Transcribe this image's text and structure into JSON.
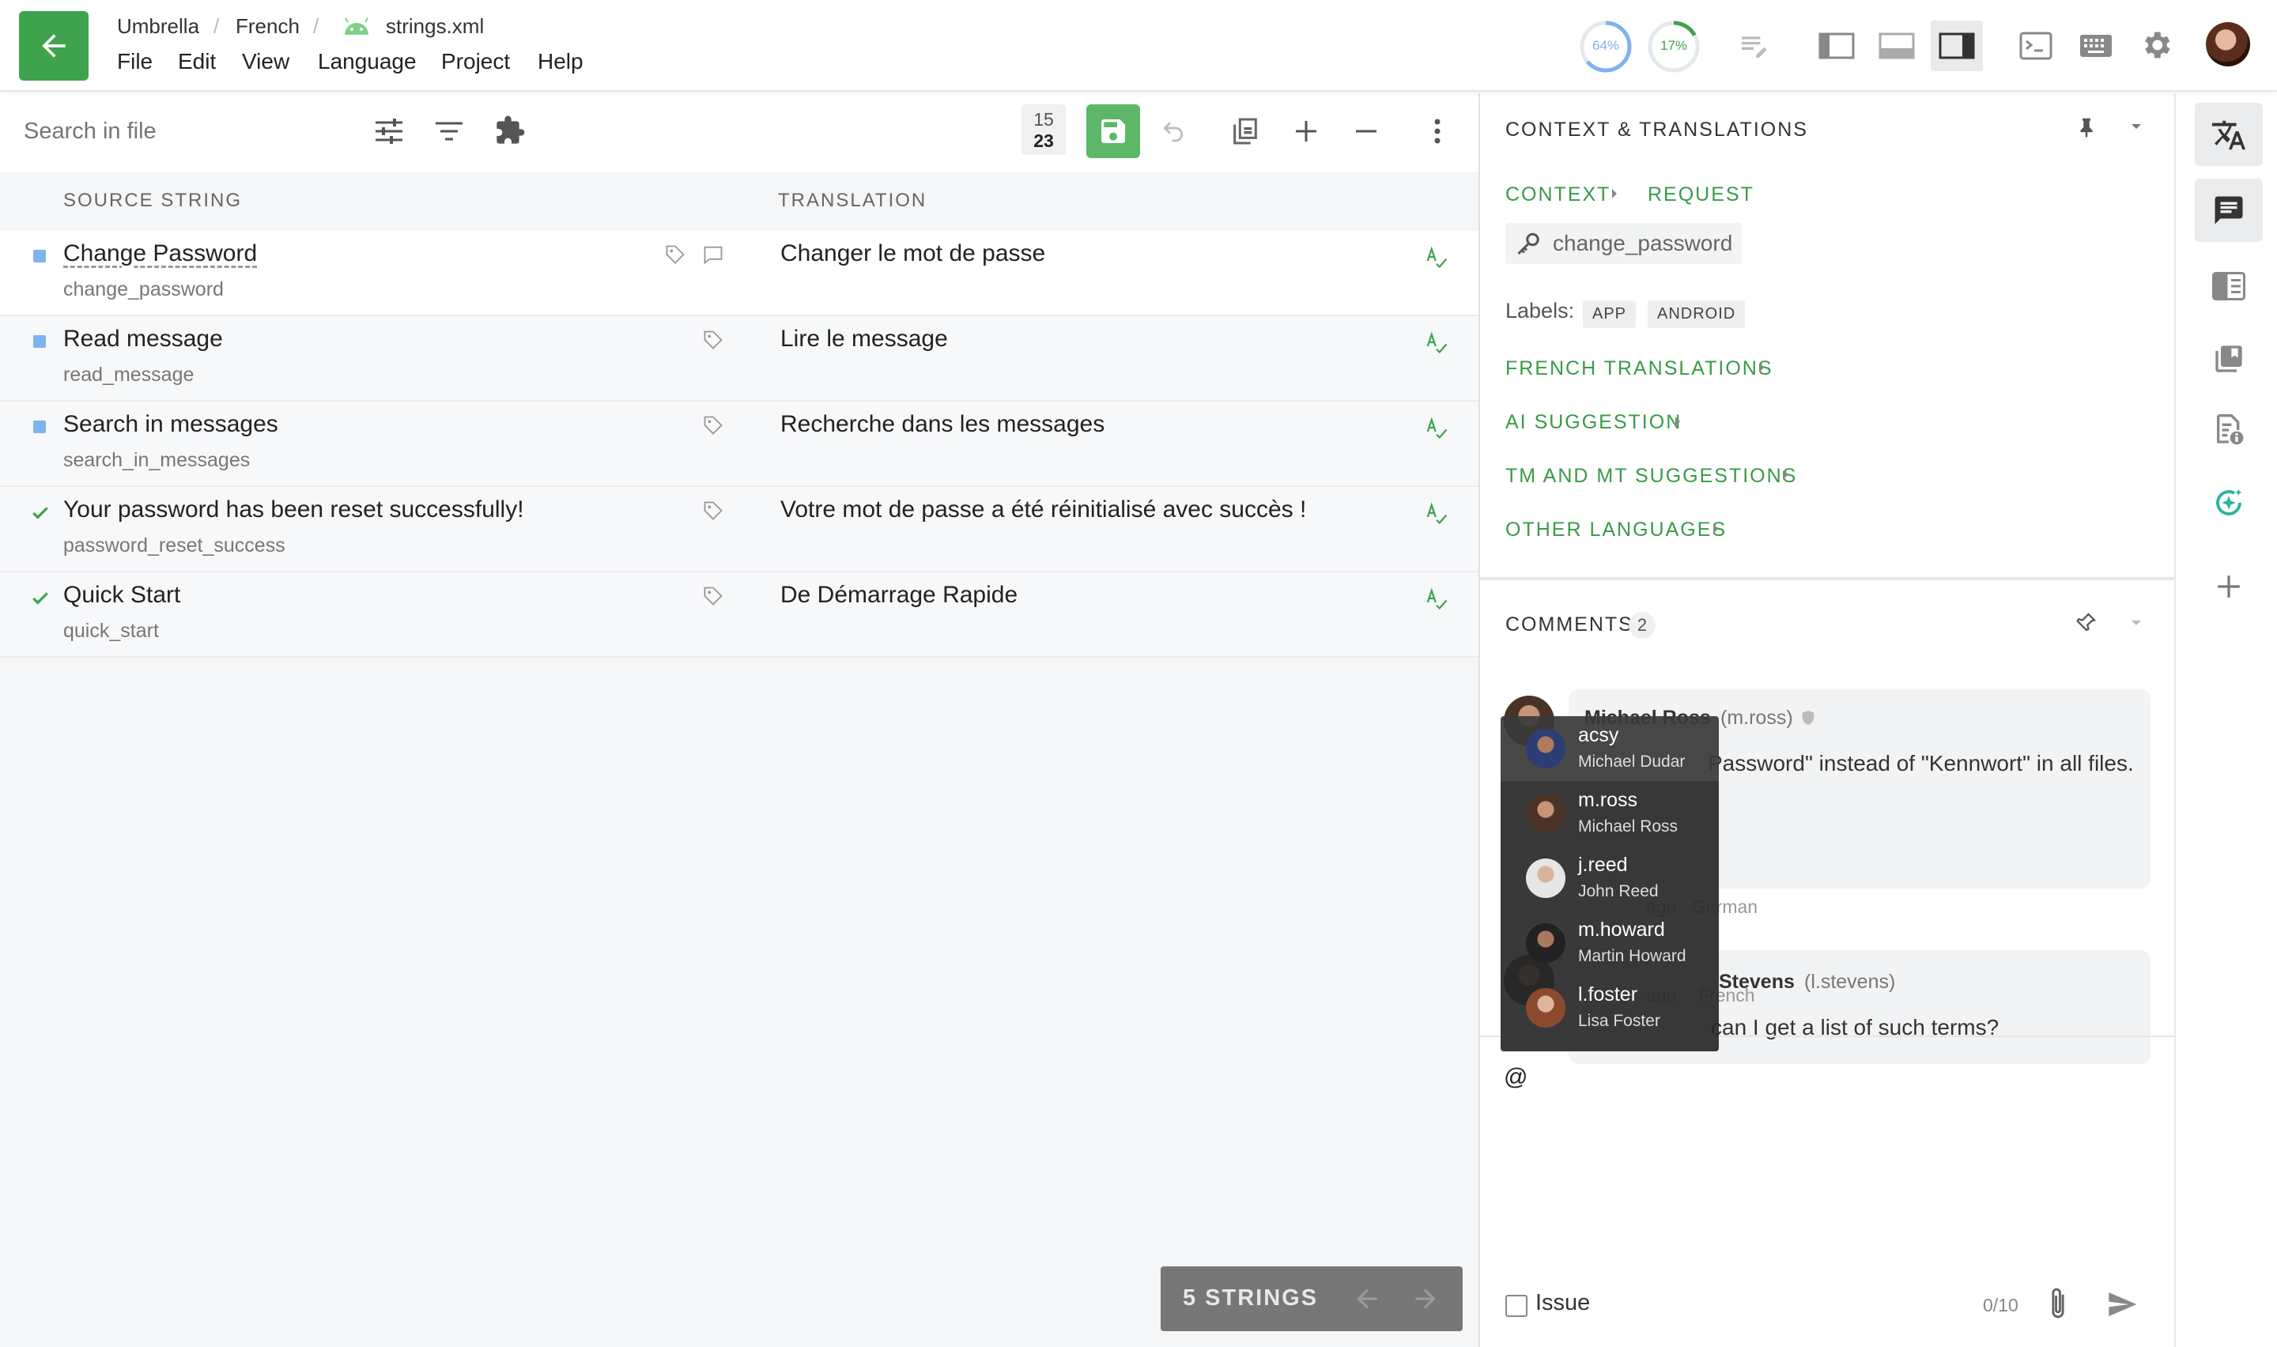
{
  "breadcrumb": {
    "project": "Umbrella",
    "language": "French",
    "file": "strings.xml"
  },
  "menu": [
    "File",
    "Edit",
    "View",
    "Language",
    "Project",
    "Help"
  ],
  "progress": {
    "translated": "64%",
    "translated_value": 0.64,
    "approved": "17%",
    "approved_value": 0.17
  },
  "colors": {
    "accent": "#3fa34d",
    "link": "#3a9a48",
    "unconfirmed": "#7fb2ee"
  },
  "editor": {
    "search_placeholder": "Search in file",
    "counter_top": "15",
    "counter_bottom": "23",
    "col_source": "SOURCE STRING",
    "col_translation": "TRANSLATION",
    "rows": [
      {
        "source": "Change Password",
        "key": "change_password",
        "translation": "Changer le mot de passe",
        "status": "unconfirmed"
      },
      {
        "source": "Read message",
        "key": "read_message",
        "translation": "Lire le message",
        "status": "unconfirmed"
      },
      {
        "source": "Search in messages",
        "key": "search_in_messages",
        "translation": "Recherche dans les messages",
        "status": "unconfirmed"
      },
      {
        "source": "Your password has been reset successfully!",
        "key": "password_reset_success",
        "translation": "Votre mot de passe a été réinitialisé avec succès !",
        "status": "approved"
      },
      {
        "source": "Quick Start",
        "key": "quick_start",
        "translation": "De Démarrage Rapide",
        "status": "approved"
      }
    ],
    "strings_count_label": "5 STRINGS"
  },
  "context_panel": {
    "title": "CONTEXT & TRANSLATIONS",
    "tab_context": "CONTEXT",
    "tab_request": "REQUEST",
    "key": "change_password",
    "labels_label": "Labels:",
    "labels": [
      "APP",
      "ANDROID"
    ],
    "sections": [
      "FRENCH TRANSLATIONS",
      "AI SUGGESTION",
      "TM AND MT SUGGESTIONS",
      "OTHER LANGUAGES"
    ]
  },
  "comments": {
    "title": "COMMENTS",
    "count": "2",
    "items": [
      {
        "author": "Michael Ross",
        "handle": "(m.ross)",
        "text_before": "Use \"",
        "text": "Password\" instead of \"Kennwort\" in all files.",
        "meta": "ago",
        "lang": "German"
      },
      {
        "author": "Stevens",
        "handle": "(l.stevens)",
        "text": "can I get a list of such terms?",
        "meta": "ago",
        "lang": "French"
      }
    ],
    "input_value": "@",
    "issue_label": "Issue",
    "char_counter": "0/10"
  },
  "mentions": [
    {
      "username": "acsy",
      "fullname": "Michael Dudar"
    },
    {
      "username": "m.ross",
      "fullname": "Michael Ross"
    },
    {
      "username": "j.reed",
      "fullname": "John Reed"
    },
    {
      "username": "m.howard",
      "fullname": "Martin Howard"
    },
    {
      "username": "l.foster",
      "fullname": "Lisa Foster"
    }
  ]
}
